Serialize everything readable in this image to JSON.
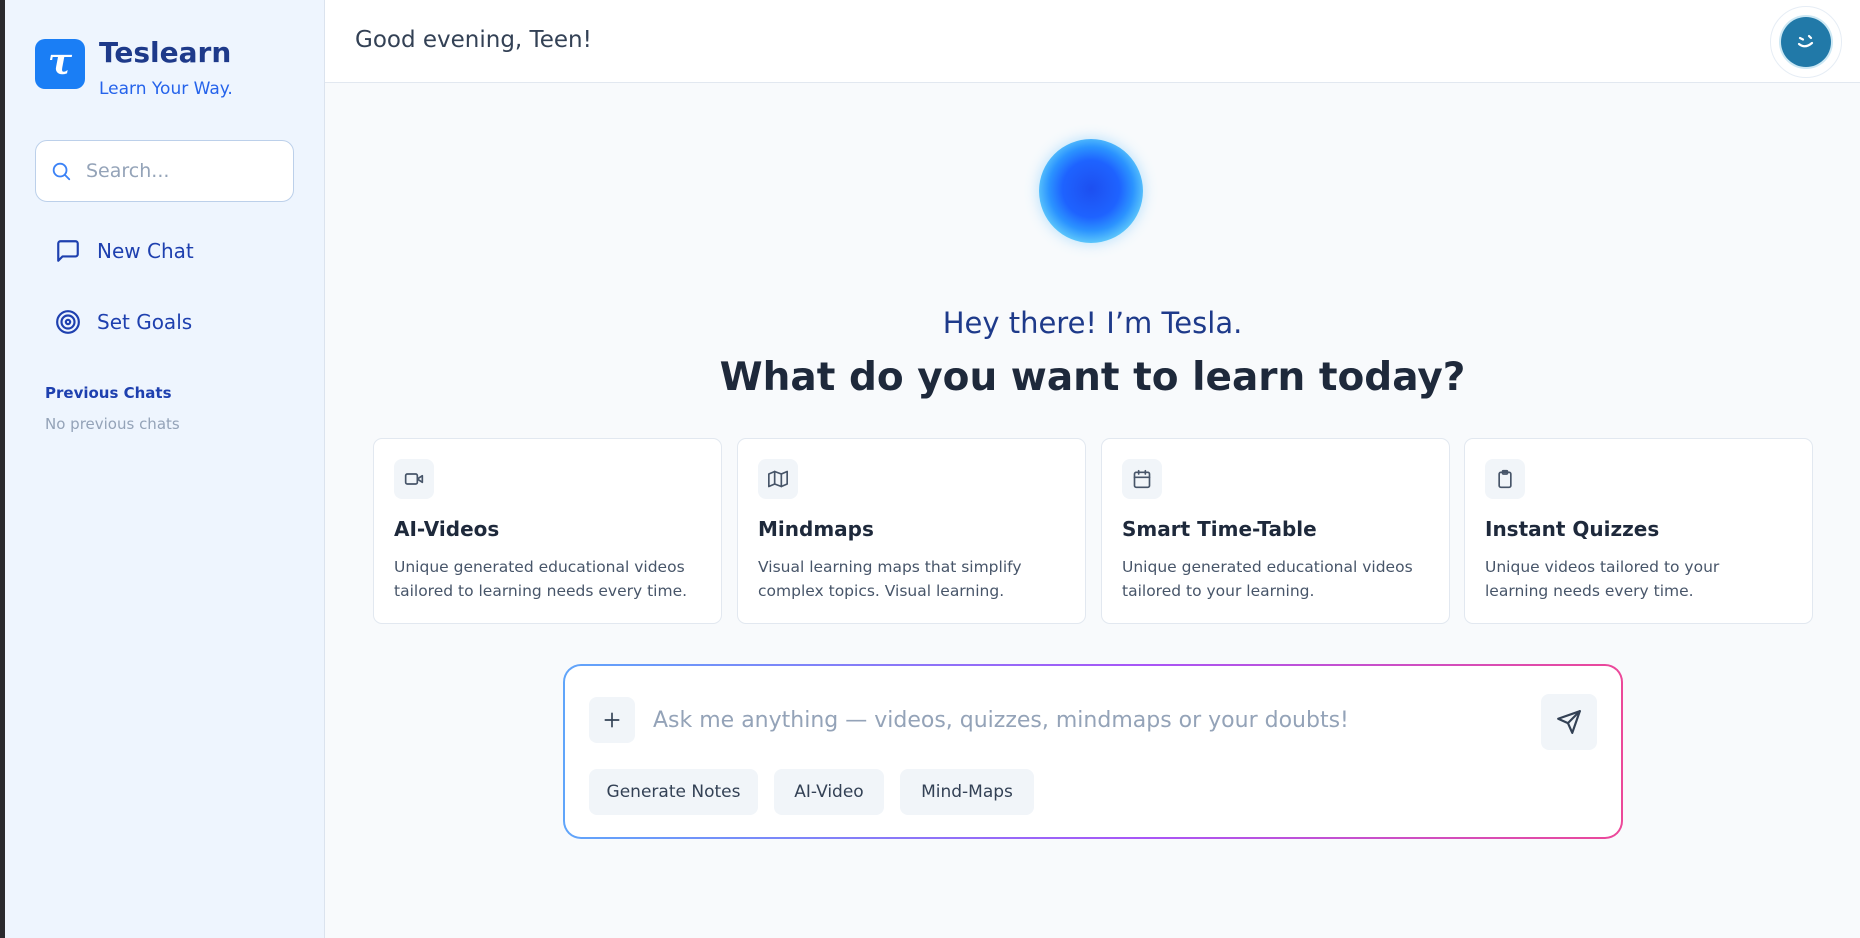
{
  "app": {
    "name": "Teslearn",
    "tagline": "Learn Your Way.",
    "logo_letter": "τ",
    "brand_color": "#1a7ef5"
  },
  "sidebar": {
    "search_placeholder": "Search...",
    "nav": [
      {
        "label": "New Chat",
        "icon": "message-square-icon"
      },
      {
        "label": "Set Goals",
        "icon": "target-icon"
      }
    ],
    "previous_chats_title": "Previous Chats",
    "previous_chats_empty": "No previous chats"
  },
  "header": {
    "greeting": "Good evening, Teen!",
    "avatar_icon": "winking-face-icon"
  },
  "hero": {
    "intro": "Hey there! I’m Tesla.",
    "headline": "What do you want to learn today?"
  },
  "features": [
    {
      "icon": "video-icon",
      "title": "AI-Videos",
      "description": "Unique generated educational videos tailored to learning needs every time."
    },
    {
      "icon": "map-icon",
      "title": "Mindmaps",
      "description": "Visual learning maps that simplify complex topics. Visual learning."
    },
    {
      "icon": "calendar-icon",
      "title": "Smart Time-Table",
      "description": "Unique generated educational videos tailored to your learning."
    },
    {
      "icon": "clipboard-icon",
      "title": "Instant Quizzes",
      "description": "Unique videos tailored to your learning needs every time."
    }
  ],
  "composer": {
    "placeholder": "Ask me anything — videos, quizzes, mindmaps or your doubts!",
    "value": "",
    "chips": [
      "Generate Notes",
      "AI-Video",
      "Mind-Maps"
    ]
  }
}
